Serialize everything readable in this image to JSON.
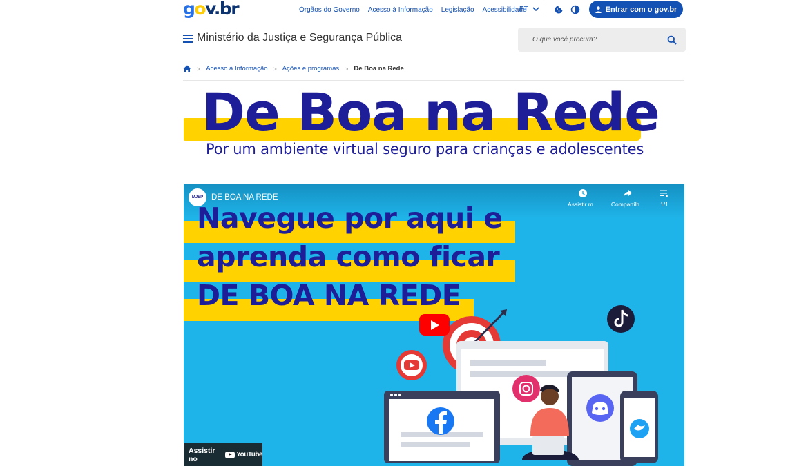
{
  "header": {
    "logo": {
      "g": "g",
      "o": "o",
      "v": "v",
      "dot": ".",
      "br": "br"
    },
    "links": [
      "Órgãos do Governo",
      "Acesso à Informação",
      "Legislação",
      "Acessibilidade"
    ],
    "language": "PT",
    "login_label": "Entrar com o gov.br"
  },
  "site": {
    "title": "Ministério da Justiça e Segurança Pública"
  },
  "search": {
    "placeholder": "O que você procura?"
  },
  "breadcrumb": {
    "items": [
      "Acesso à Informação",
      "Ações e programas"
    ],
    "current": "De Boa na Rede"
  },
  "banner": {
    "title": "De Boa na Rede",
    "subtitle": "Por um ambiente virtual seguro para crianças e adolescentes"
  },
  "video": {
    "channel_avatar": "MJSP",
    "title": "DE BOA NA REDE",
    "actions": [
      "Assistir m...",
      "Compartilh...",
      "1/1"
    ],
    "headline_lines": [
      "Navegue por aqui e",
      "aprenda como ficar",
      "DE BOA NA REDE"
    ],
    "watch_on": "Assistir no",
    "youtube": "YouTube"
  },
  "colors": {
    "primary_blue": "#1351B4",
    "banner_navy": "#1E1E98",
    "banner_yellow": "#FFD200",
    "video_bg": "#1FB4E9",
    "youtube_red": "#FF0000"
  }
}
